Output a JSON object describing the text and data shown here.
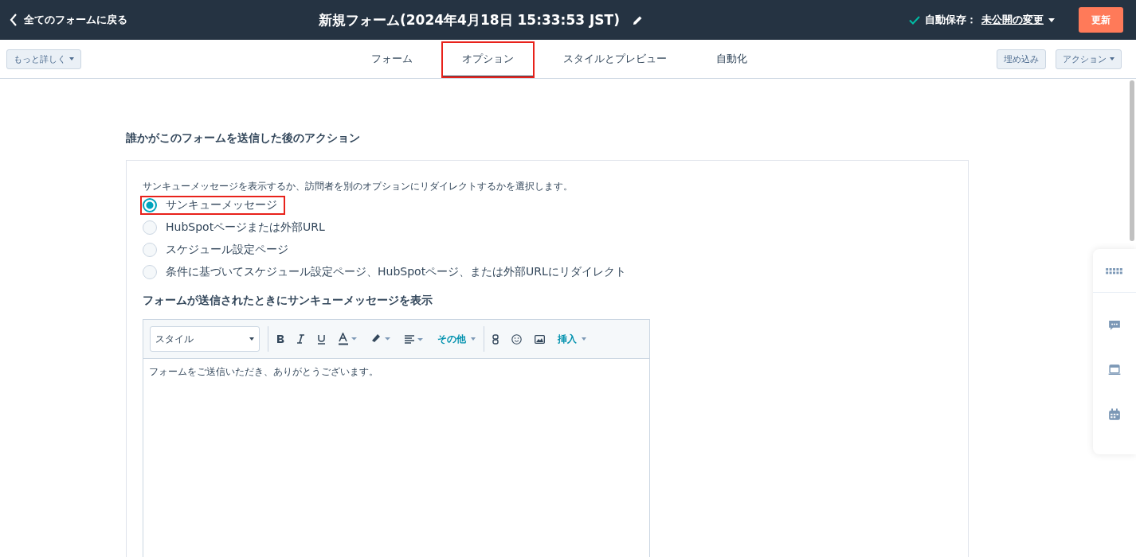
{
  "top_bar": {
    "back_link": "全てのフォームに戻る",
    "title": "新規フォーム(2024年4月18日 15:33:53 JST)",
    "autosave_label": "自動保存：",
    "autosave_link": "未公開の変更",
    "update_button": "更新"
  },
  "sub_bar": {
    "more_button": "もっと詳しく",
    "embed_button": "埋め込み",
    "actions_button": "アクション"
  },
  "tabs": [
    {
      "label": "フォーム",
      "selected": false,
      "highlighted": false
    },
    {
      "label": "オプション",
      "selected": true,
      "highlighted": true
    },
    {
      "label": "スタイルとプレビュー",
      "selected": false,
      "highlighted": false
    },
    {
      "label": "自動化",
      "selected": false,
      "highlighted": false
    }
  ],
  "section_title": "誰かがこのフォームを送信した後のアクション",
  "card": {
    "description": "サンキューメッセージを表示するか、訪問者を別のオプションにリダイレクトするかを選択します。",
    "options": [
      {
        "label": "サンキューメッセージ",
        "selected": true,
        "highlighted": true
      },
      {
        "label": "HubSpotページまたは外部URL",
        "selected": false,
        "highlighted": false
      },
      {
        "label": "スケジュール設定ページ",
        "selected": false,
        "highlighted": false
      },
      {
        "label": "条件に基づいてスケジュール設定ページ、HubSpotページ、または外部URLにリダイレクト",
        "selected": false,
        "highlighted": false
      }
    ],
    "message_heading": "フォームが送信されたときにサンキューメッセージを表示",
    "editor": {
      "style_select": "スタイル",
      "more_menu": "その他",
      "insert_menu": "挿入",
      "body": "フォームをご送信いただき、ありがとうございます。"
    }
  }
}
